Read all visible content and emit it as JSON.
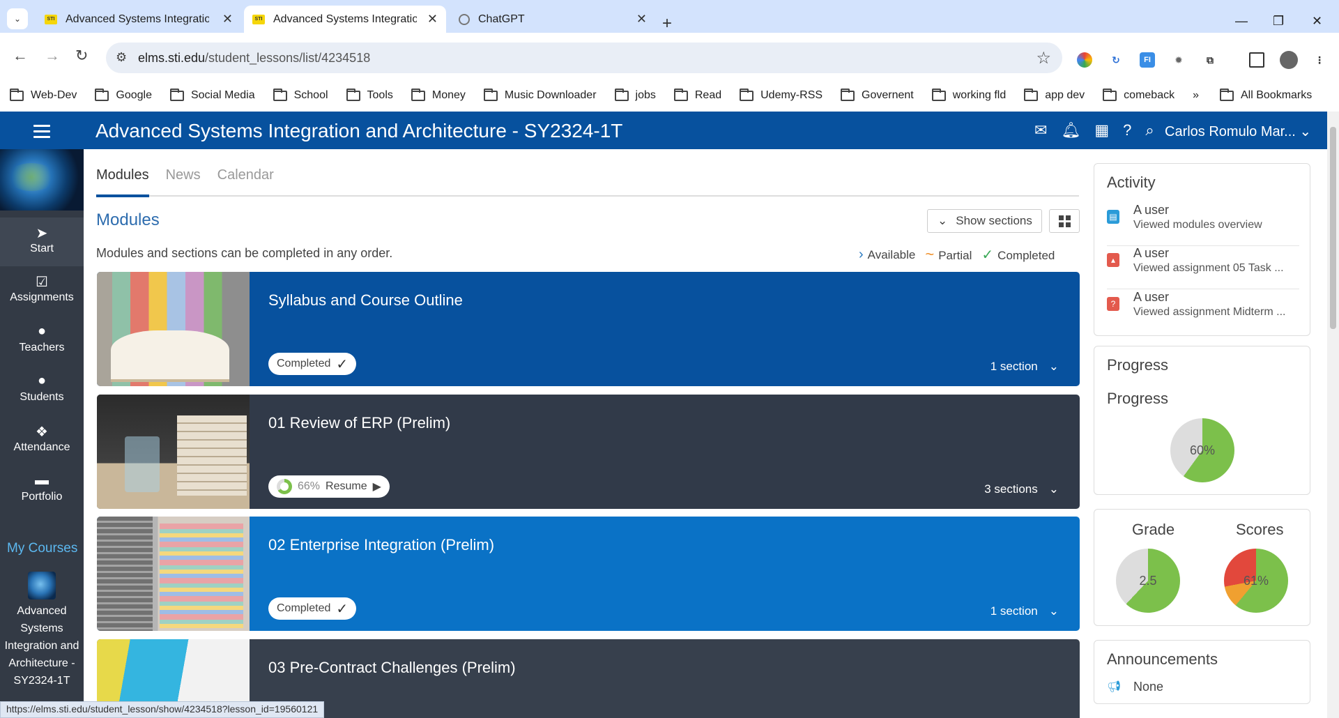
{
  "browser": {
    "tabs": [
      {
        "title": "Advanced Systems Integration",
        "favicon": "STI",
        "active": false
      },
      {
        "title": "Advanced Systems Integration",
        "favicon": "STI",
        "active": true
      },
      {
        "title": "ChatGPT",
        "favicon": "",
        "active": false
      }
    ],
    "url_host": "elms.sti.edu",
    "url_path": "/student_lessons/list/4234518",
    "bookmarks": [
      "Web-Dev",
      "Google",
      "Social Media",
      "School",
      "Tools",
      "Money",
      "Music Downloader",
      "jobs",
      "Read",
      "Udemy-RSS",
      "Governent",
      "working fld",
      "app dev",
      "comeback"
    ],
    "more_label": "»",
    "all_bookmarks": "All Bookmarks",
    "extensions": {
      "ext2": "↻",
      "ext3": "FI"
    },
    "status_url": "https://elms.sti.edu/student_lesson/show/4234518?lesson_id=19560121"
  },
  "app": {
    "title": "Advanced Systems Integration and Architecture - SY2324-1T",
    "user": "Carlos Romulo Mar...",
    "accent": "#07519e"
  },
  "sidebar": {
    "items": [
      {
        "label": "Start",
        "icon": "navigate-icon",
        "glyph": "➤"
      },
      {
        "label": "Assignments",
        "icon": "checkbox-icon",
        "glyph": "☑"
      },
      {
        "label": "Teachers",
        "icon": "person-icon",
        "glyph": "●"
      },
      {
        "label": "Students",
        "icon": "person-icon",
        "glyph": "●"
      },
      {
        "label": "Attendance",
        "icon": "group-icon",
        "glyph": "❖"
      },
      {
        "label": "Portfolio",
        "icon": "folder-icon",
        "glyph": "▬"
      }
    ],
    "my_courses": "My Courses",
    "course_name": "Advanced Systems Integration and Architecture - SY2324-1T"
  },
  "main": {
    "tabs": [
      "Modules",
      "News",
      "Calendar"
    ],
    "heading": "Modules",
    "show_sections": "Show sections",
    "order_note": "Modules and sections can be completed in any order.",
    "legend": {
      "available": "Available",
      "partial": "Partial",
      "completed": "Completed"
    },
    "modules": [
      {
        "title": "Syllabus and Course Outline",
        "status": "Completed",
        "sections": "1 section",
        "color": "#07519e"
      },
      {
        "title": "01 Review of ERP (Prelim)",
        "progress_pct": "66%",
        "action": "Resume",
        "progress_fraction": 0.66,
        "sections": "3 sections",
        "color": "#313a49"
      },
      {
        "title": "02 Enterprise Integration (Prelim)",
        "status": "Completed",
        "sections": "1 section",
        "color": "#0a72c6"
      },
      {
        "title": "03 Pre-Contract Challenges (Prelim)",
        "color": "#37404d"
      }
    ]
  },
  "right": {
    "activity_title": "Activity",
    "activity": [
      {
        "user": "A user",
        "desc": "Viewed modules overview",
        "color": "#2a9bd8"
      },
      {
        "user": "A user",
        "desc": "Viewed assignment 05 Task ...",
        "color": "#e35a4d"
      },
      {
        "user": "A user",
        "desc": "Viewed assignment Midterm ...",
        "color": "#e35a4d"
      }
    ],
    "progress_title": "Progress",
    "progress_sub": "Progress",
    "progress_value": "60%",
    "grade_label": "Grade",
    "grade_value": "2.5",
    "scores_label": "Scores",
    "scores_value": "61%",
    "announcements_title": "Announcements",
    "announcements_value": "None"
  }
}
